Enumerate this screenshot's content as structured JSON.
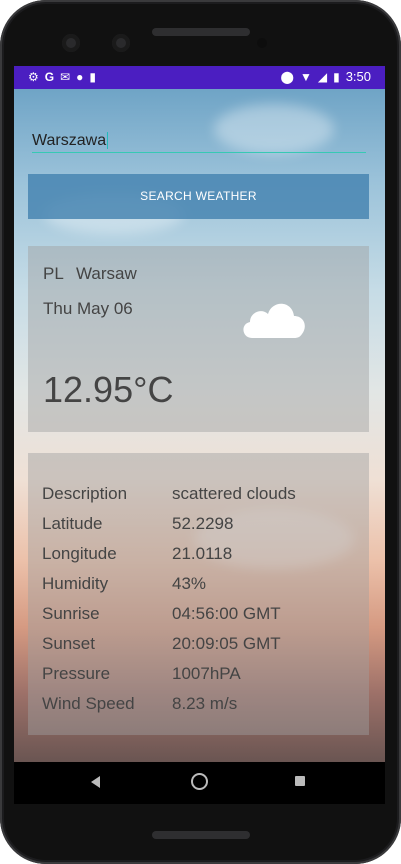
{
  "status_bar": {
    "time": "3:50"
  },
  "search": {
    "city_value": "Warszawa",
    "button_label": "SEARCH WEATHER"
  },
  "current": {
    "country": "PL",
    "city": "Warsaw",
    "date": "Thu May 06",
    "temperature": "12.95°C",
    "icon": "cloud-icon"
  },
  "details": [
    {
      "label": "Description",
      "value": "scattered clouds"
    },
    {
      "label": "Latitude",
      "value": "52.2298"
    },
    {
      "label": "Longitude",
      "value": "21.0118"
    },
    {
      "label": "Humidity",
      "value": "43%"
    },
    {
      "label": "Sunrise",
      "value": "04:56:00 GMT"
    },
    {
      "label": "Sunset",
      "value": "20:09:05 GMT"
    },
    {
      "label": "Pressure",
      "value": "1007hPA"
    },
    {
      "label": "Wind Speed",
      "value": "8.23 m/s"
    }
  ],
  "colors": {
    "status_bar": "#4b1ec1",
    "button": "#4482b0",
    "input_underline": "#37c9b4"
  }
}
